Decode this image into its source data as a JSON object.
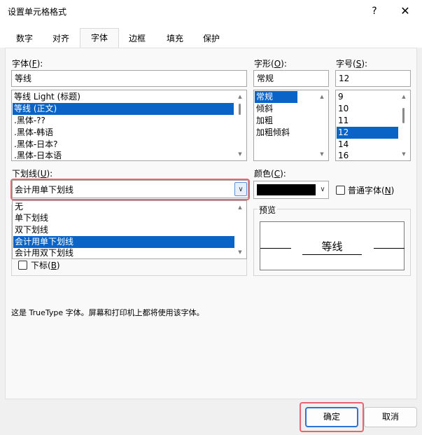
{
  "window": {
    "title": "设置单元格格式",
    "help": "?",
    "close": "✕"
  },
  "tabs": [
    {
      "label": "数字"
    },
    {
      "label": "对齐"
    },
    {
      "label": "字体"
    },
    {
      "label": "边框"
    },
    {
      "label": "填充"
    },
    {
      "label": "保护"
    }
  ],
  "font": {
    "label": "字体(",
    "accel": "F",
    "label_end": "):",
    "value": "等线",
    "items": [
      "等线 Light (标题)",
      "等线 (正文)",
      ".黑体-??",
      ".黑体-韩语",
      ".黑体-日本?",
      ".黑体-日本语"
    ],
    "selected": "等线 (正文)"
  },
  "style": {
    "label": "字形(",
    "accel": "O",
    "label_end": "):",
    "value": "常规",
    "items": [
      "常规",
      "倾斜",
      "加粗",
      "加粗倾斜"
    ],
    "selected": "常规"
  },
  "size": {
    "label": "字号(",
    "accel": "S",
    "label_end": "):",
    "value": "12",
    "items": [
      "9",
      "10",
      "11",
      "12",
      "14",
      "16"
    ],
    "selected": "12"
  },
  "underline": {
    "label": "下划线(",
    "accel": "U",
    "label_end": "):",
    "value": "会计用单下划线",
    "options": [
      "无",
      "单下划线",
      "双下划线",
      "会计用单下划线",
      "会计用双下划线"
    ],
    "selected": "会计用单下划线"
  },
  "color": {
    "label": "颜色(",
    "accel": "C",
    "label_end": "):",
    "swatch": "#000000"
  },
  "normal_font": {
    "label": "普通字体(",
    "accel": "N",
    "label_end": ")"
  },
  "effects": {
    "subscript_label": "下标(",
    "subscript_accel": "B",
    "subscript_end": ")"
  },
  "preview": {
    "label": "预览",
    "text": "等线"
  },
  "info": {
    "text": "这是 TrueType 字体。屏幕和打印机上都将使用该字体。"
  },
  "buttons": {
    "ok": "确定",
    "cancel": "取消"
  },
  "colors": {
    "accent": "#0a64c8",
    "highlight": "#e86470",
    "default_button_border": "#2c73d2"
  }
}
